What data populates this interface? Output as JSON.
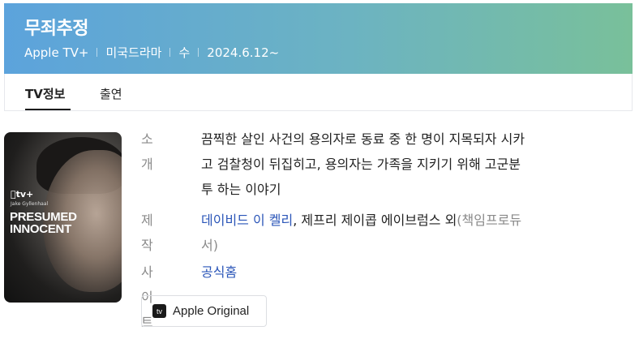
{
  "header": {
    "title": "무죄추정",
    "meta": [
      "Apple TV+",
      "미국드라마",
      "수",
      "2024.6.12~"
    ]
  },
  "tabs": [
    {
      "label": "TV정보",
      "active": true
    },
    {
      "label": "출연",
      "active": false
    }
  ],
  "poster": {
    "brand": "tv+",
    "actor": "Jake Gyllenhaal",
    "title_line1": "PRESUMED",
    "title_line2": "INNOCENT"
  },
  "info": {
    "intro_label": "소개",
    "intro_lines": [
      "끔찍한 살인 사건의 용의자로 동료 중 한 명이 지목되자 시카",
      "고 검찰청이 뒤집히고, 용의자는 가족을 지키기 위해 고군분",
      "투 하는 이야기"
    ],
    "production_label": "제작",
    "production_link": "데이비드 이 켈리",
    "production_rest": ", 제프리 제이콥 에이브럼스 외",
    "production_role_line1": "(책임프로듀",
    "production_role_line2": "서)",
    "site_label": "사이트",
    "site_link": "공식홈"
  },
  "badge": {
    "label": "Apple Original",
    "icon": "apple-tv-icon"
  },
  "colors": {
    "link": "#2a55b8",
    "label": "#8a8a8a",
    "header_start": "#5ca3dc",
    "header_end": "#79c09a"
  }
}
